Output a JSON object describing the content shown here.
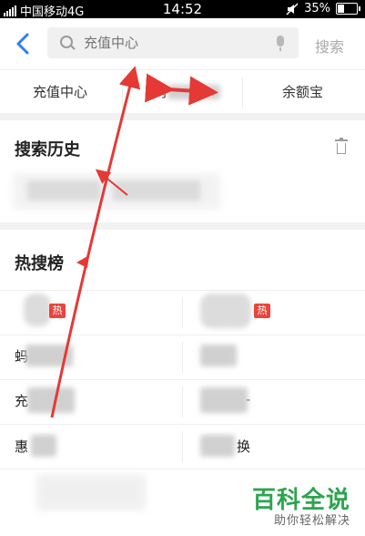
{
  "status_bar": {
    "carrier": "中国移动4G",
    "time": "14:52",
    "battery_percent_text": "35%",
    "battery_level": 0.35
  },
  "header": {
    "back_icon": "back-chevron-icon",
    "search_placeholder": "充值中心",
    "search_button": "搜索"
  },
  "quick_links": {
    "items": [
      "充值中心",
      "网",
      "余额宝"
    ]
  },
  "history": {
    "title": "搜索历史"
  },
  "hot": {
    "title": "热搜榜",
    "badge": "热",
    "left": [
      "",
      "蚂",
      "充",
      "惠"
    ],
    "right": [
      "",
      "",
      "",
      "换"
    ]
  },
  "watermark": {
    "brand": "百科全说",
    "tagline": "助你轻松解决"
  },
  "colors": {
    "accent": "#2f7ef6",
    "annotation": "#e53935",
    "hot_badge": "#e8453c",
    "watermark": "#2ea44f"
  }
}
